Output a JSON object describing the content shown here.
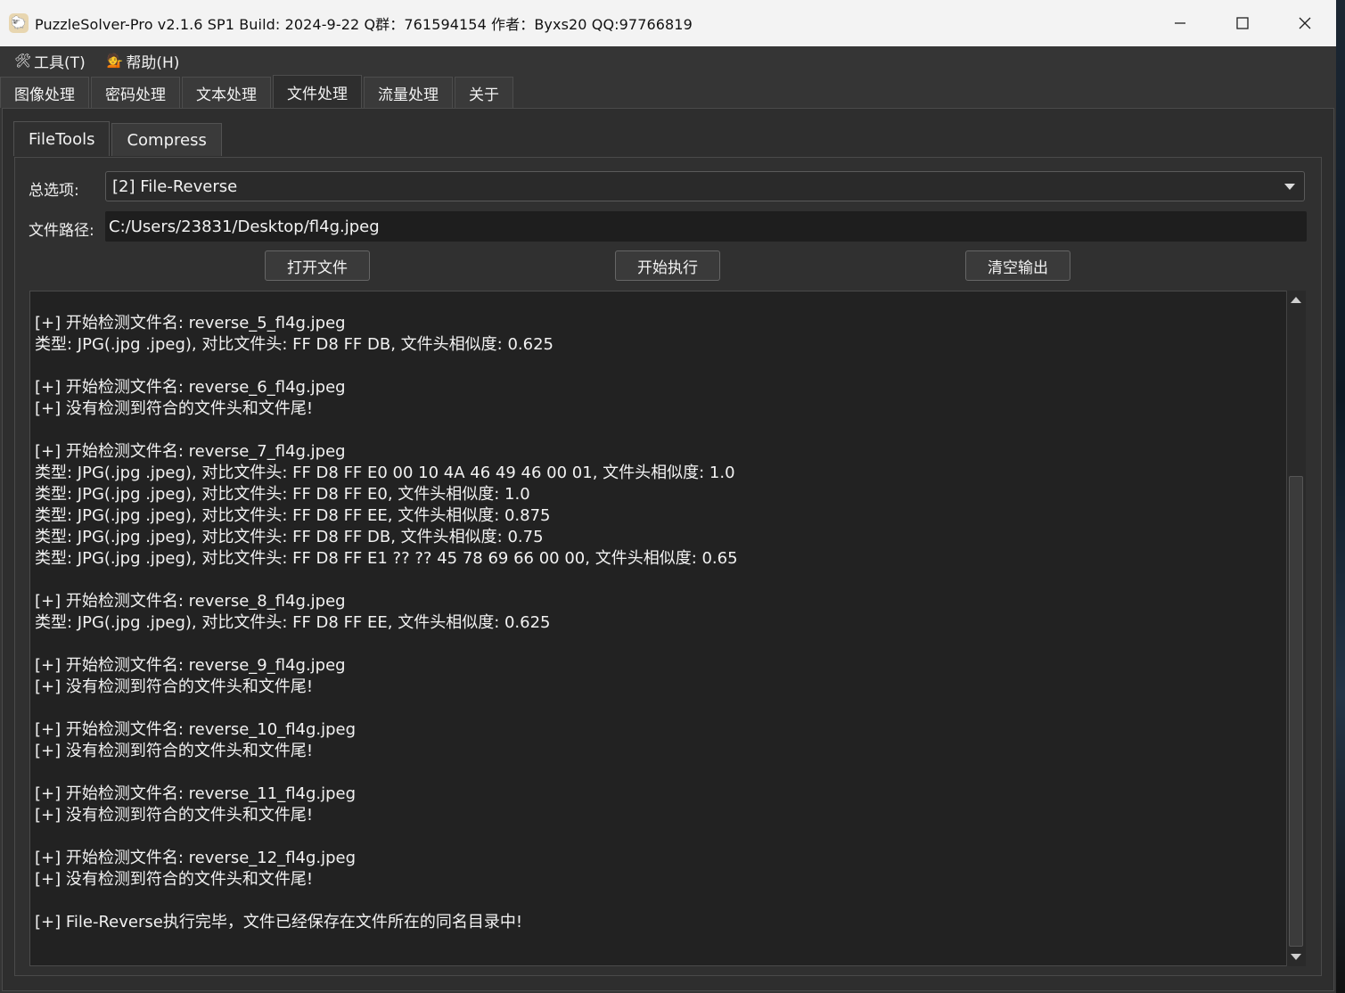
{
  "window": {
    "title": "PuzzleSolver-Pro v2.1.6 SP1  Build: 2024-9-22  Q群：761594154  作者：Byxs20  QQ:97766819",
    "app_icon": "sheep-icon"
  },
  "menu": {
    "items": [
      {
        "label": "工具(T)",
        "icon": "tools-icon",
        "glyph": "🛠"
      },
      {
        "label": "帮助(H)",
        "icon": "helper-person-icon",
        "glyph": "💁"
      }
    ]
  },
  "tabs": [
    {
      "label": "图像处理"
    },
    {
      "label": "密码处理"
    },
    {
      "label": "文本处理"
    },
    {
      "label": "文件处理",
      "active": true
    },
    {
      "label": "流量处理"
    },
    {
      "label": "关于"
    }
  ],
  "subtabs": [
    {
      "label": "FileTools",
      "active": true
    },
    {
      "label": "Compress"
    }
  ],
  "form": {
    "option_label": "总选项:",
    "option_value": "[2] File-Reverse",
    "path_label": "文件路径:",
    "path_value": "C:/Users/23831/Desktop/fl4g.jpeg"
  },
  "buttons": {
    "open": "打开文件",
    "run": "开始执行",
    "clear": "清空输出"
  },
  "output_lines": [
    "[+] 开始检测文件名: reverse_5_fl4g.jpeg",
    "类型: JPG(.jpg .jpeg), 对比文件头: FF D8 FF DB, 文件头相似度: 0.625",
    "",
    "[+] 开始检测文件名: reverse_6_fl4g.jpeg",
    "[+] 没有检测到符合的文件头和文件尾!",
    "",
    "[+] 开始检测文件名: reverse_7_fl4g.jpeg",
    "类型: JPG(.jpg .jpeg), 对比文件头: FF D8 FF E0 00 10 4A 46 49 46 00 01, 文件头相似度: 1.0",
    "类型: JPG(.jpg .jpeg), 对比文件头: FF D8 FF E0, 文件头相似度: 1.0",
    "类型: JPG(.jpg .jpeg), 对比文件头: FF D8 FF EE, 文件头相似度: 0.875",
    "类型: JPG(.jpg .jpeg), 对比文件头: FF D8 FF DB, 文件头相似度: 0.75",
    "类型: JPG(.jpg .jpeg), 对比文件头: FF D8 FF E1 ?? ?? 45 78 69 66 00 00, 文件头相似度: 0.65",
    "",
    "[+] 开始检测文件名: reverse_8_fl4g.jpeg",
    "类型: JPG(.jpg .jpeg), 对比文件头: FF D8 FF EE, 文件头相似度: 0.625",
    "",
    "[+] 开始检测文件名: reverse_9_fl4g.jpeg",
    "[+] 没有检测到符合的文件头和文件尾!",
    "",
    "[+] 开始检测文件名: reverse_10_fl4g.jpeg",
    "[+] 没有检测到符合的文件头和文件尾!",
    "",
    "[+] 开始检测文件名: reverse_11_fl4g.jpeg",
    "[+] 没有检测到符合的文件头和文件尾!",
    "",
    "[+] 开始检测文件名: reverse_12_fl4g.jpeg",
    "[+] 没有检测到符合的文件头和文件尾!",
    "",
    "[+] File-Reverse执行完毕，文件已经保存在文件所在的同名目录中!"
  ]
}
